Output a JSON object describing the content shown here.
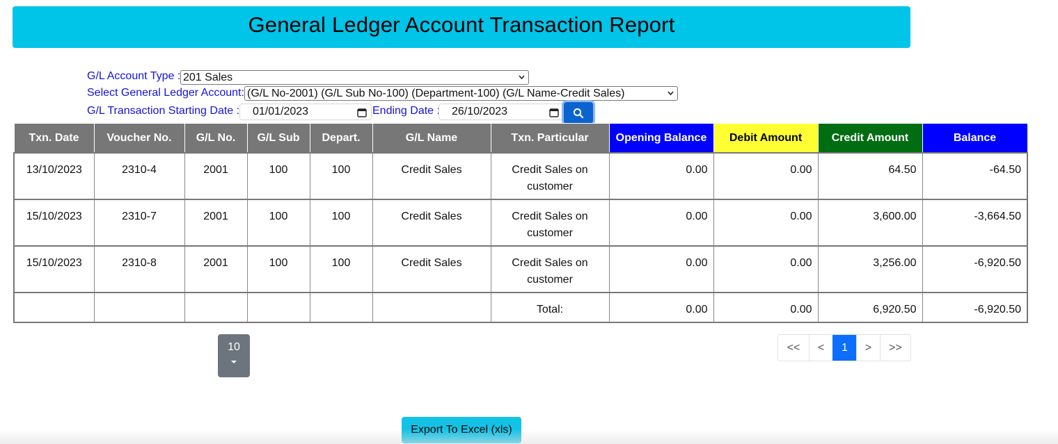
{
  "header": {
    "title": "General Ledger Account Transaction Report"
  },
  "filters": {
    "account_type_label": "G/L Account Type :",
    "account_type_value": "201 Sales",
    "account_label": "Select General Ledger Account:",
    "account_value": "(G/L No-2001) (G/L Sub No-100) (Department-100) (G/L Name-Credit Sales)",
    "start_date_label": "G/L Transaction Starting Date :",
    "start_date_value": "01/01/2023",
    "end_date_label": "Ending Date :",
    "end_date_value": "26/10/2023",
    "search_icon": "search-icon"
  },
  "table": {
    "columns": [
      "Txn. Date",
      "Voucher No.",
      "G/L No.",
      "G/L Sub",
      "Depart.",
      "G/L Name",
      "Txn. Particular",
      "Opening Balance",
      "Debit Amount",
      "Credit Amount",
      "Balance"
    ],
    "rows": [
      [
        "13/10/2023",
        "2310-4",
        "2001",
        "100",
        "100",
        "Credit Sales",
        "Credit Sales on customer",
        "0.00",
        "0.00",
        "64.50",
        "-64.50"
      ],
      [
        "15/10/2023",
        "2310-7",
        "2001",
        "100",
        "100",
        "Credit Sales",
        "Credit Sales on customer",
        "0.00",
        "0.00",
        "3,600.00",
        "-3,664.50"
      ],
      [
        "15/10/2023",
        "2310-8",
        "2001",
        "100",
        "100",
        "Credit Sales",
        "Credit Sales on customer",
        "0.00",
        "0.00",
        "3,256.00",
        "-6,920.50"
      ]
    ],
    "total": {
      "label": "Total:",
      "opening": "0.00",
      "debit": "0.00",
      "credit": "6,920.50",
      "balance": "-6,920.50"
    },
    "header_colors": {
      "default": "#777777",
      "opening_balance": "#0000ff",
      "debit_amount": "#ffff33",
      "credit_amount": "#006d12",
      "balance": "#0000ff"
    }
  },
  "page_size": {
    "value": "10",
    "icon": "caret-down-icon"
  },
  "pagination": {
    "first": "<<",
    "prev": "<",
    "current": "1",
    "next": ">",
    "last": ">>"
  },
  "export": {
    "label": "Export To Excel (xls)"
  },
  "colors": {
    "banner": "#00c4e8",
    "accent": "#0d6efd",
    "label": "#1414d9"
  }
}
